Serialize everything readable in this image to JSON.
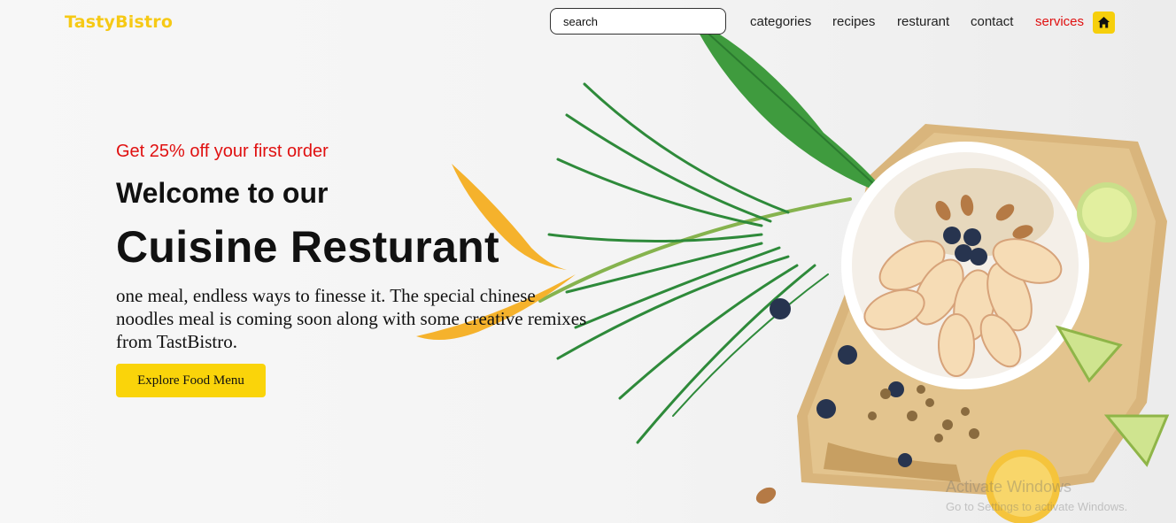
{
  "header": {
    "logo": "TastyBistro",
    "search_placeholder": "search",
    "nav": [
      {
        "label": "categories"
      },
      {
        "label": "recipes"
      },
      {
        "label": "resturant"
      },
      {
        "label": "contact"
      },
      {
        "label": "services"
      }
    ],
    "home_icon": "home-icon"
  },
  "hero": {
    "promo": "Get 25% off your first order",
    "welcome": "Welcome to our",
    "title": "Cuisine Resturant",
    "description": "one meal, endless ways to finesse it. The special chinese noodles meal is coming soon along with some creative remixes from TastBistro.",
    "cta_label": "Explore Food Menu"
  },
  "watermark": {
    "title": "Activate Windows",
    "subtitle": "Go to Settings to activate Windows."
  },
  "colors": {
    "brand_yellow": "#f6c915",
    "accent_red": "#e01010",
    "button_yellow": "#fad40a"
  }
}
